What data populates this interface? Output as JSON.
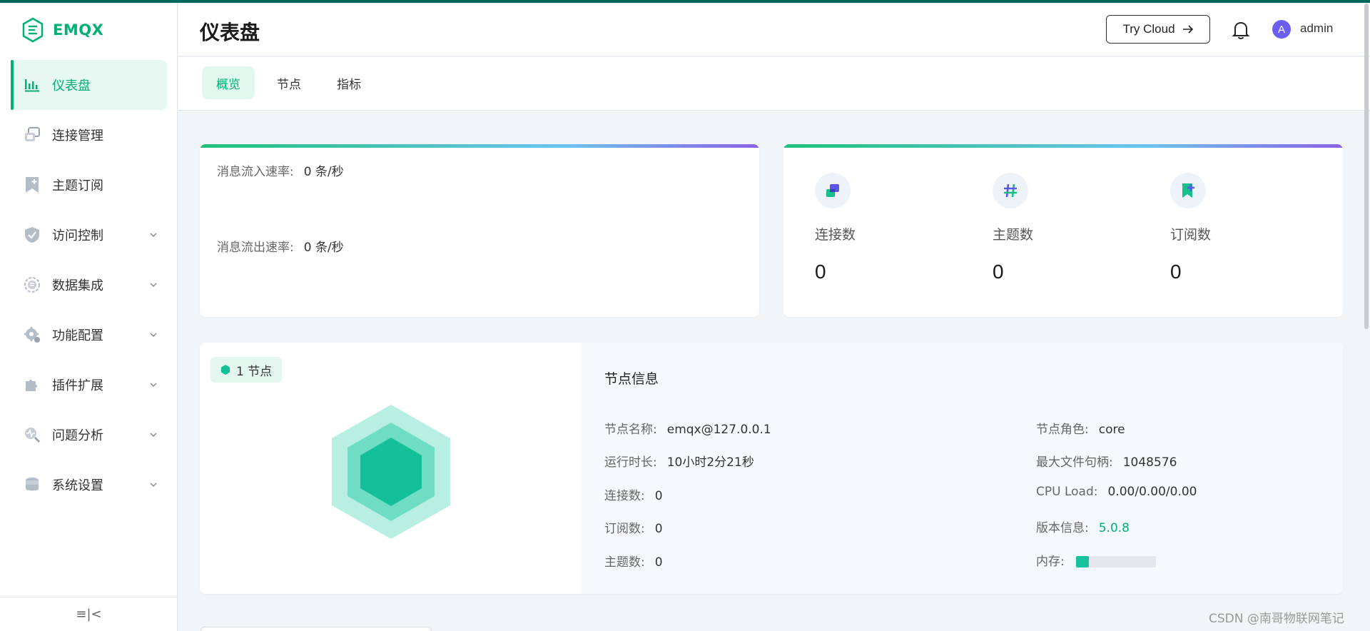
{
  "app": {
    "logo_text": "EMQX",
    "brand_color": "#00b173"
  },
  "sidebar": {
    "items": [
      {
        "label": "仪表盘",
        "icon": "dashboard-chart-icon",
        "active": true,
        "expandable": false
      },
      {
        "label": "连接管理",
        "icon": "connections-icon",
        "active": false,
        "expandable": false
      },
      {
        "label": "主题订阅",
        "icon": "subscription-bookmark-icon",
        "active": false,
        "expandable": false
      },
      {
        "label": "访问控制",
        "icon": "shield-icon",
        "active": false,
        "expandable": true
      },
      {
        "label": "数据集成",
        "icon": "data-integration-icon",
        "active": false,
        "expandable": true
      },
      {
        "label": "功能配置",
        "icon": "gear-icon",
        "active": false,
        "expandable": true
      },
      {
        "label": "插件扩展",
        "icon": "plugin-puzzle-icon",
        "active": false,
        "expandable": true
      },
      {
        "label": "问题分析",
        "icon": "diagnose-icon",
        "active": false,
        "expandable": true
      },
      {
        "label": "系统设置",
        "icon": "system-settings-icon",
        "active": false,
        "expandable": true
      }
    ],
    "collapse_glyph": "≡|<"
  },
  "header": {
    "title": "仪表盘",
    "try_cloud_label": "Try Cloud",
    "user_initial": "A",
    "username": "admin"
  },
  "tabs": [
    {
      "label": "概览",
      "active": true
    },
    {
      "label": "节点",
      "active": false
    },
    {
      "label": "指标",
      "active": false
    }
  ],
  "rates": {
    "in_label": "消息流入速率:",
    "in_value": "0 条/秒",
    "out_label": "消息流出速率:",
    "out_value": "0 条/秒"
  },
  "stats": [
    {
      "label": "连接数",
      "value": "0",
      "icon": "connections-stat-icon"
    },
    {
      "label": "主题数",
      "value": "0",
      "icon": "hash-topic-icon"
    },
    {
      "label": "订阅数",
      "value": "0",
      "icon": "subscription-stat-icon"
    }
  ],
  "node": {
    "badge": "1 节点",
    "info_title": "节点信息",
    "left": [
      {
        "label": "节点名称:",
        "value": "emqx@127.0.0.1"
      },
      {
        "label": "运行时长:",
        "value": "10小时2分21秒"
      },
      {
        "label": "连接数:",
        "value": "0"
      },
      {
        "label": "订阅数:",
        "value": "0"
      },
      {
        "label": "主题数:",
        "value": "0"
      }
    ],
    "right": [
      {
        "label": "节点角色:",
        "value": "core"
      },
      {
        "label": "最大文件句柄:",
        "value": "1048576"
      },
      {
        "label": "CPU Load:",
        "value": "0.00/0.00/0.00"
      },
      {
        "label": "版本信息:",
        "value": "5.0.8"
      },
      {
        "label": "内存:",
        "value": ""
      }
    ],
    "memory_fraction": 0.16
  },
  "watermark": "CSDN @南哥物联网笔记"
}
